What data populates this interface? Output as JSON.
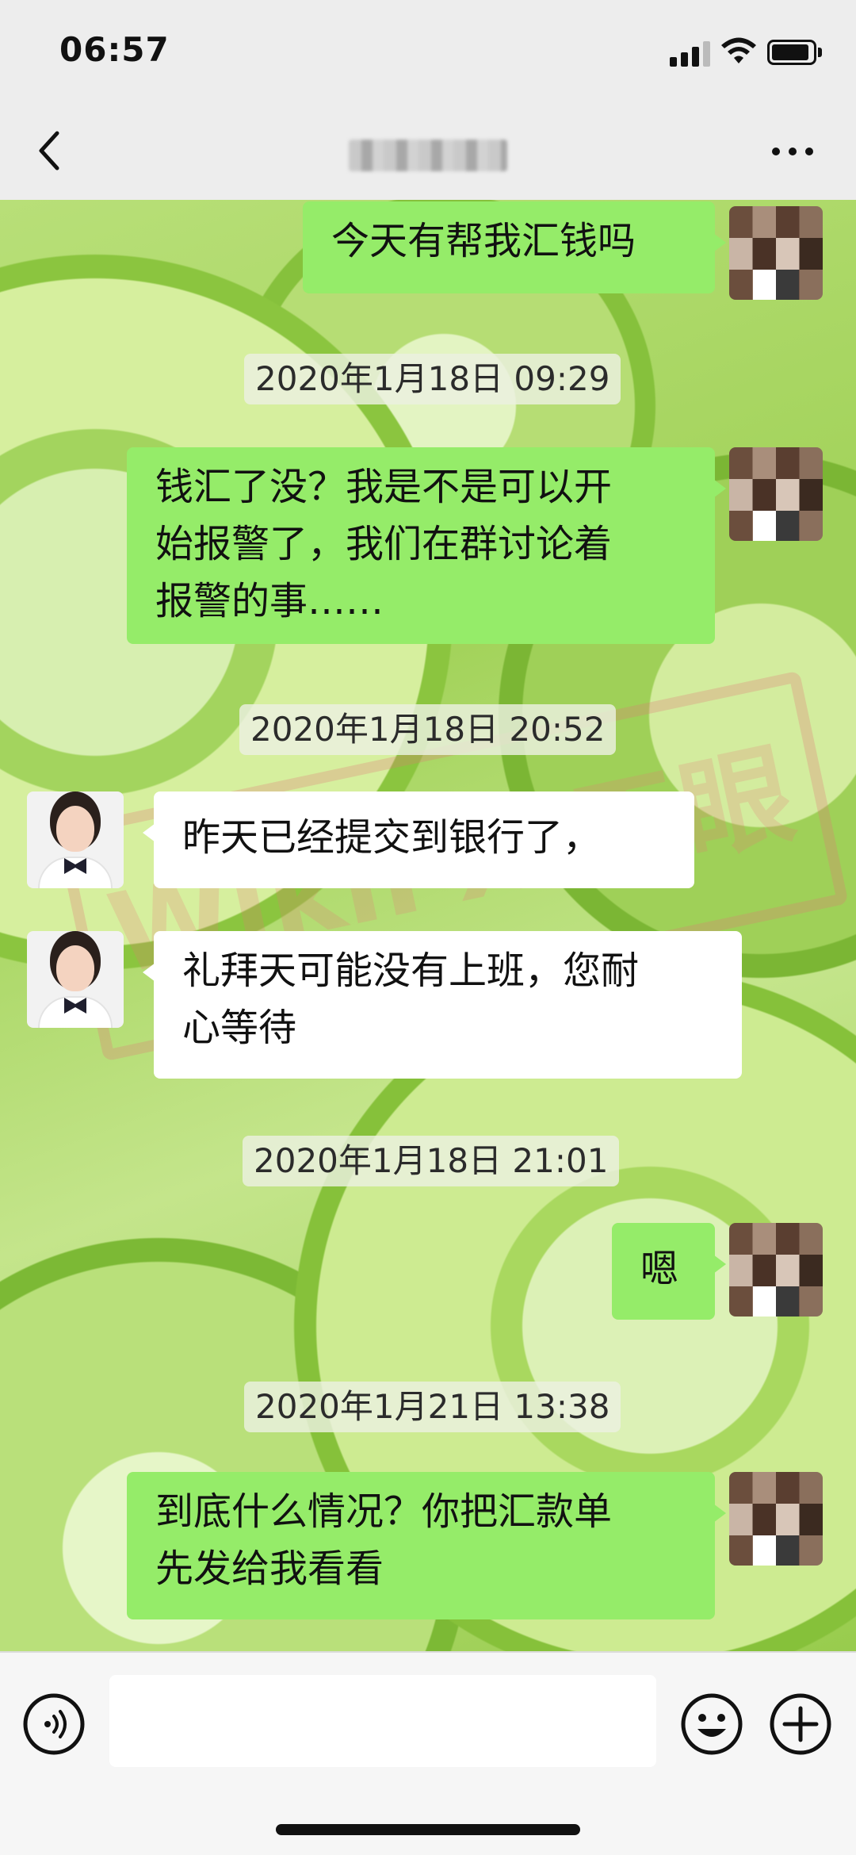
{
  "status_bar": {
    "time": "06:57",
    "icons": [
      "signal-icon",
      "wifi-icon",
      "battery-icon"
    ]
  },
  "nav": {
    "back_icon": "chevron-left-icon",
    "title": "",
    "more_icon": "more-dots-icon"
  },
  "messages": [
    {
      "type": "sent",
      "text": "今天有帮我汇钱吗"
    },
    {
      "type": "time",
      "text": "2020年1月18日 09:29"
    },
    {
      "type": "sent",
      "text": "钱汇了没？我是不是可以开\n始报警了，我们在群讨论着\n报警的事……"
    },
    {
      "type": "time",
      "text": "2020年1月18日 20:52"
    },
    {
      "type": "received",
      "text": "昨天已经提交到银行了，"
    },
    {
      "type": "received",
      "text": "礼拜天可能没有上班，您耐\n心等待"
    },
    {
      "type": "time",
      "text": "2020年1月18日 21:01"
    },
    {
      "type": "sent",
      "text": "嗯"
    },
    {
      "type": "time",
      "text": "2020年1月21日 13:38"
    },
    {
      "type": "sent",
      "text": "到底什么情况？你把汇款单\n先发给我看看"
    }
  ],
  "watermark": {
    "text": "WikiFX 天眼"
  },
  "input_bar": {
    "voice_icon": "voice-icon",
    "input_value": "",
    "emoji_icon": "emoji-icon",
    "plus_icon": "plus-icon"
  },
  "colors": {
    "sent_bubble": "#95ec69",
    "received_bubble": "#ffffff",
    "chrome_bg": "#ededed"
  }
}
